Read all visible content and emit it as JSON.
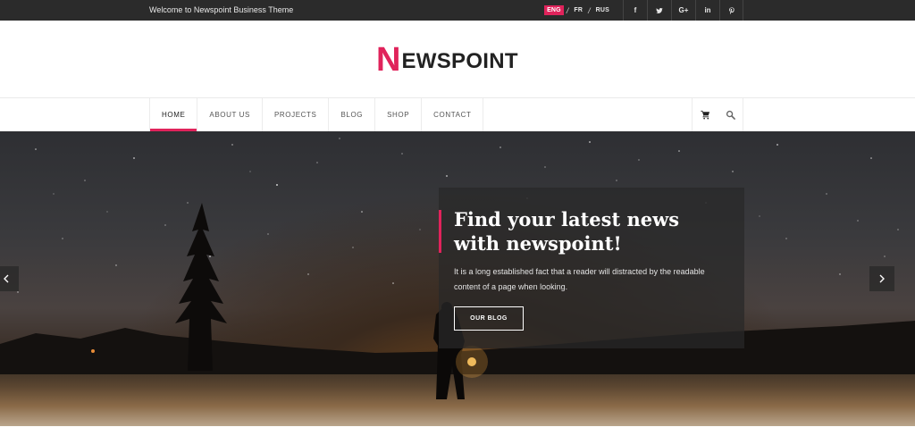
{
  "topbar": {
    "welcome": "Welcome to Newspoint Business Theme",
    "languages": [
      "ENG",
      "FR",
      "RUS"
    ],
    "active_language": "ENG",
    "separator": "/",
    "social": [
      {
        "name": "facebook-icon",
        "glyph": "f"
      },
      {
        "name": "twitter-icon",
        "glyph": ""
      },
      {
        "name": "google-plus-icon",
        "glyph": "G+"
      },
      {
        "name": "linkedin-icon",
        "glyph": "in"
      },
      {
        "name": "pinterest-icon",
        "glyph": ""
      }
    ]
  },
  "logo": {
    "initial": "N",
    "rest": "EWSPOINT"
  },
  "nav": {
    "items": [
      "HOME",
      "ABOUT US",
      "PROJECTS",
      "BLOG",
      "SHOP",
      "CONTACT"
    ],
    "active": "HOME",
    "tools": [
      "cart-icon",
      "search-icon"
    ]
  },
  "hero": {
    "headline_line1": "Find your latest news",
    "headline_line2": "with newspoint!",
    "body": "It is a long established fact that a reader will distracted by the readable content of a page when looking.",
    "button_label": "OUR BLOG"
  },
  "colors": {
    "accent": "#e0235b",
    "topbar_bg": "#2b2b2b",
    "text_dark": "#222222"
  }
}
